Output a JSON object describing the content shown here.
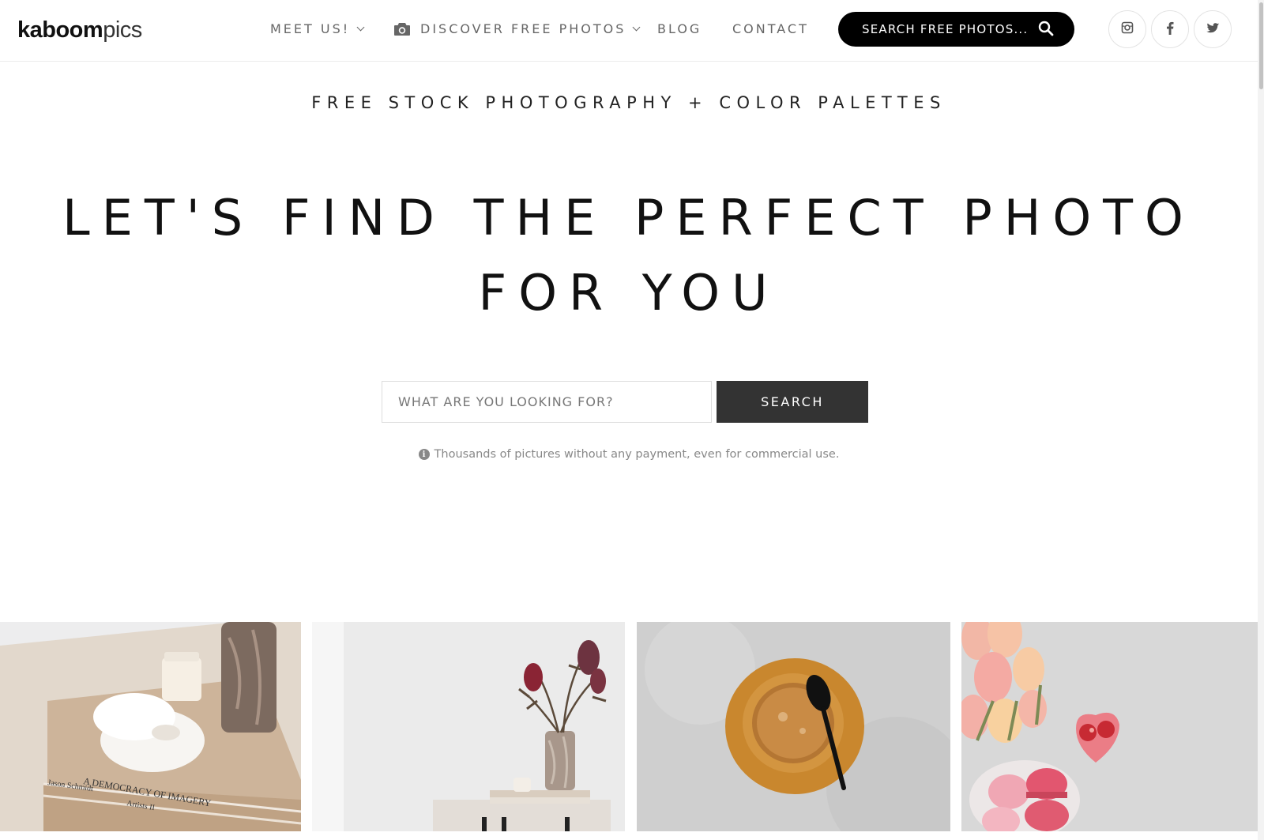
{
  "header": {
    "logo_bold": "kaboom",
    "logo_light": "pics",
    "nav": [
      {
        "label": "MEET US!"
      },
      {
        "label": "DISCOVER FREE PHOTOS"
      },
      {
        "label": "BLOG"
      },
      {
        "label": "CONTACT"
      }
    ],
    "search_label": "SEARCH FREE PHOTOS...",
    "social": [
      "instagram-icon",
      "facebook-icon",
      "twitter-icon"
    ]
  },
  "hero": {
    "tagline": "FREE STOCK PHOTOGRAPHY + COLOR PALETTES",
    "headline_line1": "LET'S FIND THE PERFECT PHOTO",
    "headline_line2": "FOR YOU",
    "search_placeholder": "WHAT ARE YOU LOOKING FOR?",
    "search_button": "SEARCH",
    "info_text": "Thousands of pictures without any payment, even for commercial use."
  },
  "photos": [
    {
      "subject": "marble bowl on books",
      "book_title": "A DEMOCRACY OF IMAGERY",
      "book_author": "Jason Schmidt",
      "book_sub": "Artists II"
    },
    {
      "subject": "protea flowers in vase on side table"
    },
    {
      "subject": "coffee cup on saucer with black spoon"
    },
    {
      "subject": "pink tulips and macarons"
    }
  ],
  "colors": {
    "accent_dark": "#000000",
    "button": "#333333",
    "text_muted": "#888888"
  }
}
